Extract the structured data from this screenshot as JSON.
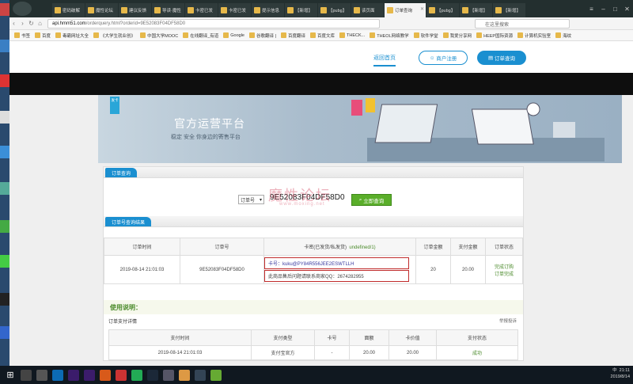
{
  "browser": {
    "tabs": [
      {
        "label": "密码破解"
      },
      {
        "label": "魔性论坛"
      },
      {
        "label": "建议反馈"
      },
      {
        "label": "导读·魔性"
      },
      {
        "label": "卡密已发"
      },
      {
        "label": "卡密已发"
      },
      {
        "label": "提示信息"
      },
      {
        "label": "【新增】"
      },
      {
        "label": "【pubg】"
      },
      {
        "label": "该页面"
      },
      {
        "label": "订单查询",
        "active": true
      },
      {
        "label": "【pubg】"
      },
      {
        "label": "【新增】"
      },
      {
        "label": "【新增】"
      }
    ],
    "url_host": "api.hmm51.com",
    "url_path": "/orderquery.html?orderid=9E52083F04DF58D0",
    "search_placeholder": "在这里搜索",
    "bookmarks": [
      "书签",
      "百度",
      "毒霸网址大全",
      "《大学生就业创》",
      "中国大学MOOC",
      "在线翻译_有道",
      "Google",
      "谷歌翻译 |",
      "百度翻译",
      "百度文库",
      "THECK...",
      "THEOL网络教学",
      "软件学堂",
      "我爱分享网",
      "HEEP国际资源",
      "计算机实验室",
      "海纹"
    ]
  },
  "site": {
    "nav_home": "返回首页",
    "btn_register": "商户注册",
    "btn_orderquery": "订单查询",
    "banner_title": "官方运营平台",
    "banner_sub": "稳定 安全 你身边的寄售平台",
    "flag_text": "发卡"
  },
  "query": {
    "section_title": "订单查询",
    "select_value": "订单号",
    "order_id": "9E52083F04DF58D0",
    "query_button": "立即查询",
    "watermark": "魔性论坛",
    "watermark_sub": "www.moxing.net"
  },
  "result": {
    "section_title": "订单号查询结果",
    "headers": [
      "订单时间",
      "订单号",
      "卡密(已发货/私发货)",
      "订单金额",
      "支付金额",
      "订单状态"
    ],
    "key_header_extra": "undefined/1)",
    "row": {
      "time": "2019-08-14 21:01:03",
      "order_no": "9E52083F04DF58D0",
      "card_key": "卡号：kuku@PY84R556JEE2ESWTLLH",
      "card_note": "此商品售后问题请联系商家QQ：2674282955",
      "amount": "20",
      "paid": "20.00",
      "status1": "完成订购",
      "status2": "订单完成"
    }
  },
  "usage": {
    "title": "使用说明：",
    "pay_label": "订单支付详情",
    "report": "举报投诉",
    "headers": [
      "支付时间",
      "支付类型",
      "卡号",
      "面额",
      "卡价值",
      "支付状态"
    ],
    "row": {
      "time": "2019-08-14 21:01:03",
      "type": "支付宝官方",
      "card": "-",
      "face": "20.00",
      "value": "20.00",
      "status": "成功"
    }
  },
  "taskbar": {
    "time": "21:11",
    "date": "2019/8/14",
    "lang": "中"
  },
  "colors": {
    "accent": "#1a8fd0",
    "query_button": "#5aae2a",
    "key_border": "#c02c2c"
  }
}
